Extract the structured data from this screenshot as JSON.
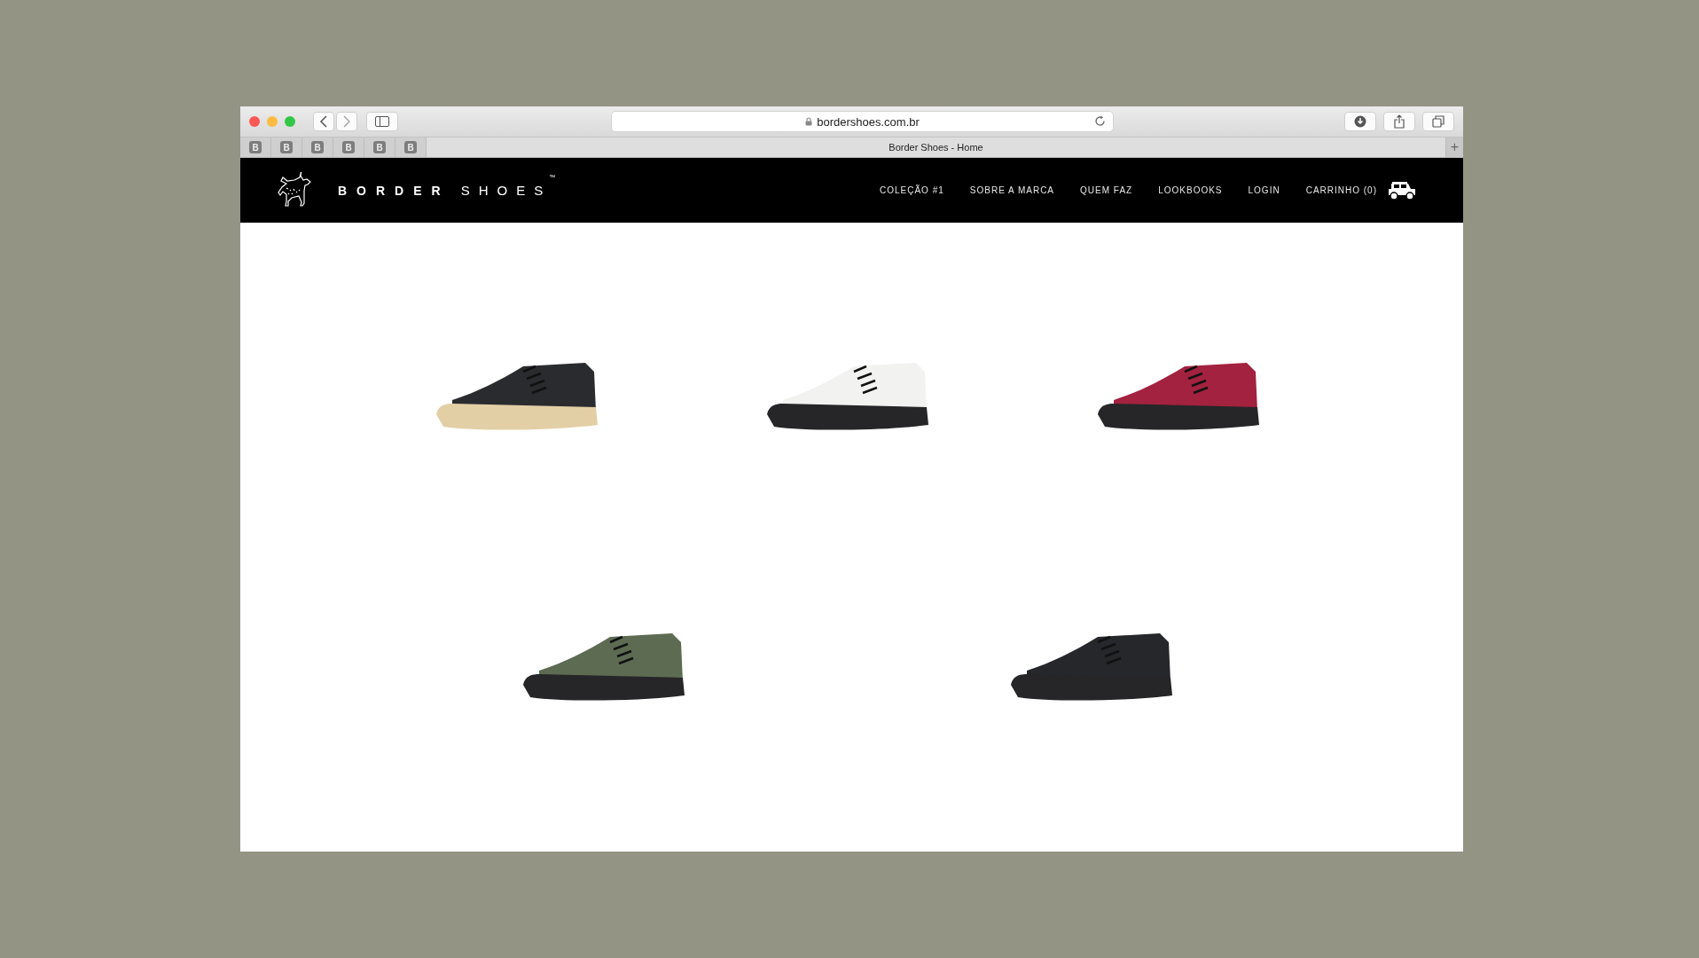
{
  "browser": {
    "url": "bordershoes.com.br",
    "pinned_tabs": [
      {
        "label": "B",
        "selected": false
      },
      {
        "label": "B",
        "selected": false
      },
      {
        "label": "B",
        "selected": false
      },
      {
        "label": "B",
        "selected": false
      },
      {
        "label": "B",
        "selected": false
      },
      {
        "label": "B",
        "selected": false
      }
    ],
    "tab": {
      "title": "Border Shoes - Home",
      "selected": true
    },
    "new_tab": "+"
  },
  "site": {
    "brand_bold": "BORDER",
    "brand_light": "SHOES",
    "trademark": "™",
    "nav": [
      "COLEÇÃO #1",
      "SOBRE A MARCA",
      "QUEM FAZ",
      "LOOKBOOKS",
      "LOGIN",
      "CARRINHO (0)"
    ]
  },
  "product_rows": [
    [
      {
        "color": "#2a2b2f",
        "kind": "crepe"
      },
      {
        "color": "#f2f2f0",
        "kind": "rubber"
      },
      {
        "color": "#a3223f",
        "kind": "rubber"
      }
    ],
    [
      {
        "color": "#5d6b52",
        "kind": "rubber"
      },
      {
        "color": "#25272b",
        "kind": "rubber"
      }
    ]
  ]
}
